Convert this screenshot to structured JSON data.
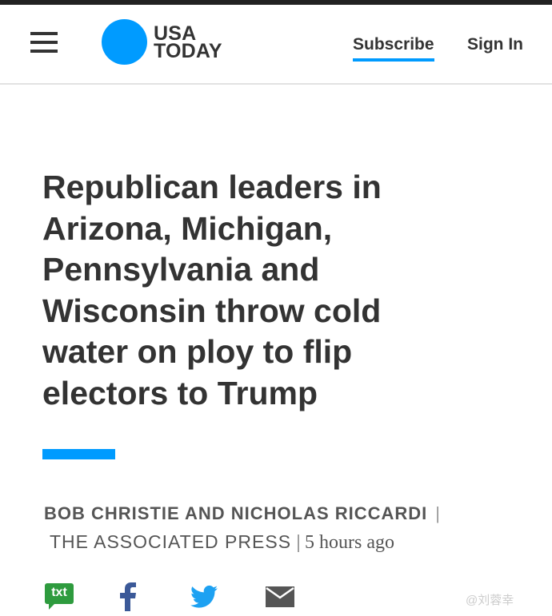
{
  "header": {
    "menu_icon": "hamburger-menu-icon",
    "logo_line1": "USA",
    "logo_line2": "TODAY",
    "subscribe_label": "Subscribe",
    "signin_label": "Sign In"
  },
  "article": {
    "headline": "Republican leaders in Arizona, Michigan, Pennsylvania and Wisconsin throw cold water on ploy to flip electors to Trump",
    "authors": "BOB CHRISTIE AND NICHOLAS RICCARDI",
    "source": "THE ASSOCIATED PRESS",
    "separator": "|",
    "time": "5 hours ago"
  },
  "share": {
    "sms_label": "txt",
    "icons": [
      "sms-icon",
      "facebook-icon",
      "twitter-icon",
      "email-icon"
    ]
  },
  "watermark": "@刘蓉幸",
  "colors": {
    "accent": "#009bff",
    "text": "#333333",
    "sms": "#2e9b3e",
    "facebook": "#3b5998",
    "twitter": "#1da1f2",
    "email": "#555555"
  }
}
